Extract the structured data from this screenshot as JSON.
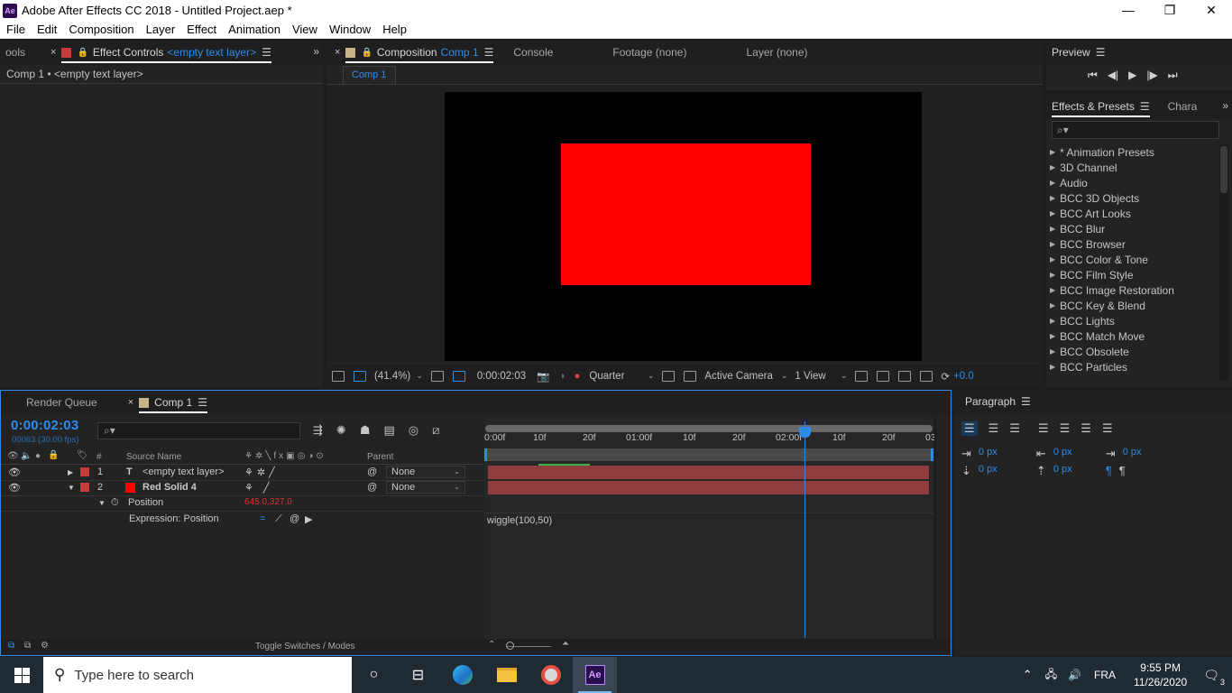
{
  "window": {
    "title": "Adobe After Effects CC 2018 - Untitled Project.aep *",
    "logo": "Ae",
    "controls": [
      "—",
      "❐",
      "✕"
    ]
  },
  "menu": [
    "File",
    "Edit",
    "Composition",
    "Layer",
    "Effect",
    "Animation",
    "View",
    "Window",
    "Help"
  ],
  "left_panel": {
    "tab_tools": "ools",
    "tab_effect_controls": "Effect Controls",
    "tab_effect_controls_target": "<empty text layer>",
    "subtitle": "Comp 1 • <empty text layer>"
  },
  "comp_panel": {
    "tab_composition": "Composition",
    "tab_composition_name": "Comp 1",
    "tab_console": "Console",
    "tab_footage": "Footage (none)",
    "tab_layer": "Layer (none)",
    "comp_sub_tab": "Comp 1",
    "solid_color": "#ff0000",
    "footer": {
      "zoom": "(41.4%)",
      "timecode": "0:00:02:03",
      "resolution": "Quarter",
      "camera": "Active Camera",
      "views": "1 View",
      "exposure": "+0.0"
    }
  },
  "preview_panel": {
    "title": "Preview",
    "controls": [
      "⏮",
      "◀|",
      "▶",
      "|▶",
      "⏭"
    ]
  },
  "effects_panel": {
    "tab_effects": "Effects & Presets",
    "tab_char": "Chara",
    "search_placeholder": "⌕▾",
    "items": [
      "* Animation Presets",
      "3D Channel",
      "Audio",
      "BCC 3D Objects",
      "BCC Art Looks",
      "BCC Blur",
      "BCC Browser",
      "BCC Color & Tone",
      "BCC Film Style",
      "BCC Image Restoration",
      "BCC Key & Blend",
      "BCC Lights",
      "BCC Match Move",
      "BCC Obsolete",
      "BCC Particles"
    ]
  },
  "timeline": {
    "tab_render_queue": "Render Queue",
    "tab_comp": "Comp 1",
    "timecode": "0:00:02:03",
    "frame_info": "00063 (30.00 fps)",
    "search_placeholder": "⌕▾",
    "columns": {
      "num": "#",
      "source_name": "Source Name",
      "parent": "Parent"
    },
    "layers": [
      {
        "num": "1",
        "type_icon": "T",
        "name": "<empty text layer>",
        "parent": "None",
        "label_color": "#c53a3a"
      },
      {
        "num": "2",
        "type_icon": "■",
        "name": "Red Solid 4",
        "parent": "None",
        "label_color": "#c53a3a"
      }
    ],
    "position_label": "Position",
    "position_value": "645.0,327.0",
    "expression_label": "Expression: Position",
    "expression_text": "wiggle(100,50)",
    "ruler_labels": [
      "0:00f",
      "10f",
      "20f",
      "01:00f",
      "10f",
      "20f",
      "02:00f",
      "10f",
      "20f",
      "03"
    ],
    "footer_toggle": "Toggle Switches / Modes"
  },
  "paragraph_panel": {
    "title": "Paragraph",
    "indent_left": "0 px",
    "indent_right": "0 px",
    "indent_first": "0 px",
    "space_before": "0 px",
    "space_after": "0 px"
  },
  "taskbar": {
    "search_placeholder": "Type here to search",
    "language": "FRA",
    "time": "9:55 PM",
    "date": "11/26/2020",
    "notifications": "3"
  }
}
